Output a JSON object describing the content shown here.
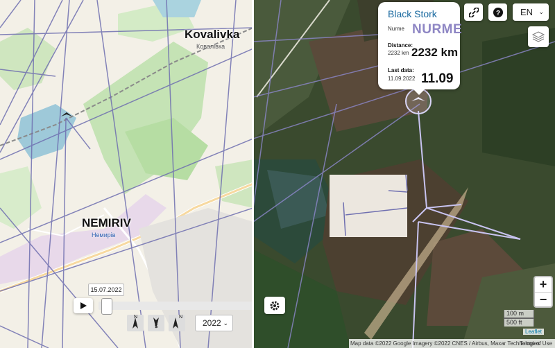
{
  "map_left": {
    "places": {
      "kovalivka_en": "Kovalivka",
      "kovalivka_ua": "Ковалівка",
      "nemiriv_en": "NEMIRIV",
      "nemiriv_ua": "Немирів"
    }
  },
  "popup": {
    "species": "Black Stork",
    "name_label": "Nurme",
    "name_value": "NURME",
    "distance_label": "Distance:",
    "distance_small": "2232 km",
    "distance_big": "2232 km",
    "last_data_label": "Last data:",
    "last_data_date": "11.09.2022",
    "last_data_big": "11.09"
  },
  "controls": {
    "language": "EN",
    "zoom_in": "+",
    "zoom_out": "−",
    "scale_m": "100 m",
    "scale_ft": "500 ft",
    "link_icon": "link-icon",
    "help_icon": "question-icon",
    "layers_icon": "layers-icon",
    "settings_icon": "gear-icon"
  },
  "timeline": {
    "date": "15.07.2022",
    "year": "2022",
    "play_icon": "play-icon",
    "compass_labels": [
      "N",
      "S",
      "N"
    ]
  },
  "attribution": {
    "text": "Map data ©2022 Google Imagery ©2022 CNES / Airbus, Maxar Technologies",
    "terms": "Terms of Use",
    "leaflet": "Leaflet"
  },
  "colors": {
    "track": "#6f6fb0",
    "track_light": "#c8c3f0",
    "popup_name": "#8e86c4",
    "species": "#1a6aa0"
  }
}
